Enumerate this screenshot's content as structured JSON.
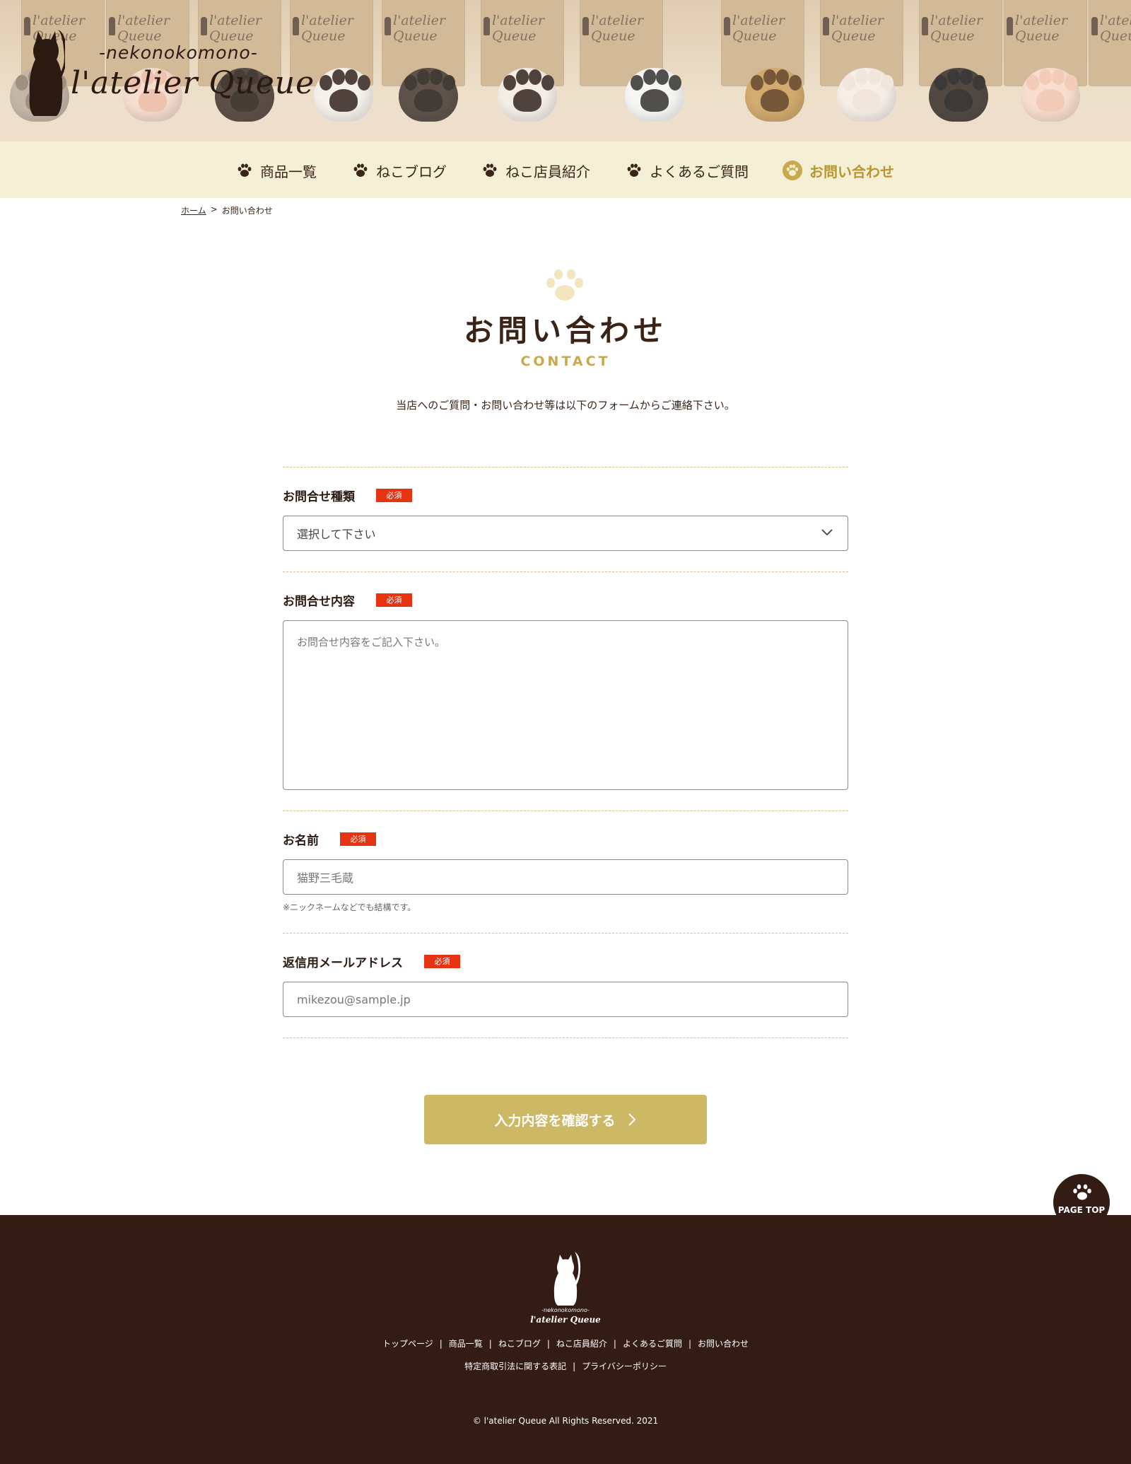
{
  "logo": {
    "subtitle": "-nekonokomono-",
    "name": "l'atelier Queue",
    "icon": "cat-silhouette-icon"
  },
  "nav": {
    "items": [
      {
        "label": "商品一覧",
        "icon": "paw-icon"
      },
      {
        "label": "ねこブログ",
        "icon": "paw-icon"
      },
      {
        "label": "ねこ店員紹介",
        "icon": "paw-icon"
      },
      {
        "label": "よくあるご質問",
        "icon": "paw-icon"
      },
      {
        "label": "お問い合わせ",
        "icon": "paw-circle-icon",
        "active": true
      }
    ]
  },
  "breadcrumb": {
    "home": "ホーム",
    "separator": ">",
    "current": "お問い合わせ"
  },
  "page": {
    "title": "お問い合わせ",
    "subtitle": "CONTACT",
    "lead": "当店へのご質問・お問い合わせ等は以下のフォームからご連絡下さい。"
  },
  "form": {
    "required_badge": "必須",
    "type": {
      "label": "お問合せ種類",
      "selected": "選択して下さい"
    },
    "message": {
      "label": "お問合せ内容",
      "placeholder": "お問合せ内容をご記入下さい。"
    },
    "name": {
      "label": "お名前",
      "placeholder": "猫野三毛蔵",
      "note": "※ニックネームなどでも結構です。"
    },
    "email": {
      "label": "返信用メールアドレス",
      "placeholder": "mikezou@sample.jp"
    },
    "submit": "入力内容を確認する"
  },
  "page_top": {
    "label": "PAGE TOP"
  },
  "footer": {
    "logo_subtitle": "-nekonokomono-",
    "logo_name": "l'atelier Queue",
    "links_row1": [
      "トップページ",
      "商品一覧",
      "ねこブログ",
      "ねこ店員紹介",
      "よくあるご質問",
      "お問い合わせ"
    ],
    "links_row2": [
      "特定商取引法に関する表記",
      "プライバシーポリシー"
    ],
    "separator": "|",
    "copyright": "© l'atelier Queue All Rights Reserved. 2021"
  },
  "colors": {
    "brown": "#331c13",
    "gold": "#c9a94e",
    "button": "#cdb866",
    "nav_bg": "#f5efd6",
    "required": "#e63312"
  }
}
